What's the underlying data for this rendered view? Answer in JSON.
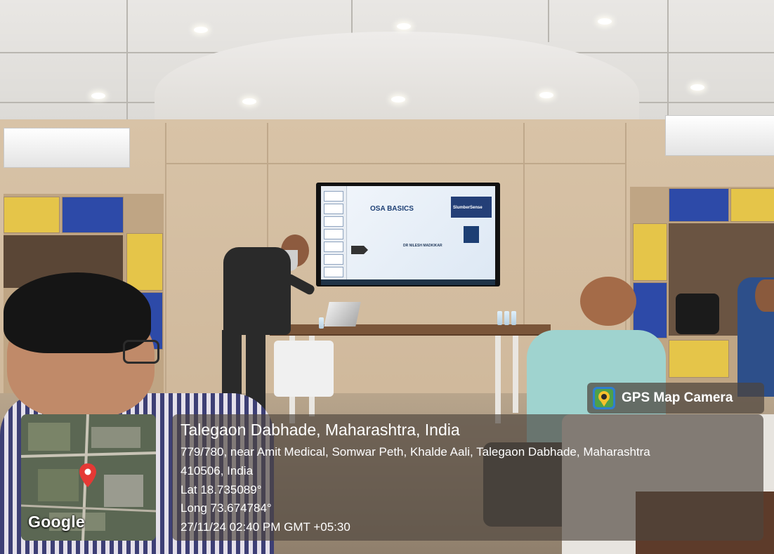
{
  "slide": {
    "title": "OSA BASICS",
    "logo_text": "SlumberSense",
    "presenter": "DR NILESH MADKIKAR"
  },
  "gps_badge": {
    "icon": "camera-pin-icon",
    "label": "GPS Map Camera"
  },
  "location": {
    "title": "Talegaon Dabhade, Maharashtra, India",
    "address_line1": "779/780, near Amit Medical, Somwar Peth, Khalde Aali, Talegaon Dabhade, Maharashtra",
    "address_line2": "410506, India",
    "lat": "Lat 18.735089°",
    "long": "Long 73.674784°",
    "timestamp": "27/11/24 02:40 PM GMT +05:30"
  },
  "map": {
    "brand": "Google",
    "pin_icon": "map-pin-icon",
    "pin_color": "#e53935"
  }
}
